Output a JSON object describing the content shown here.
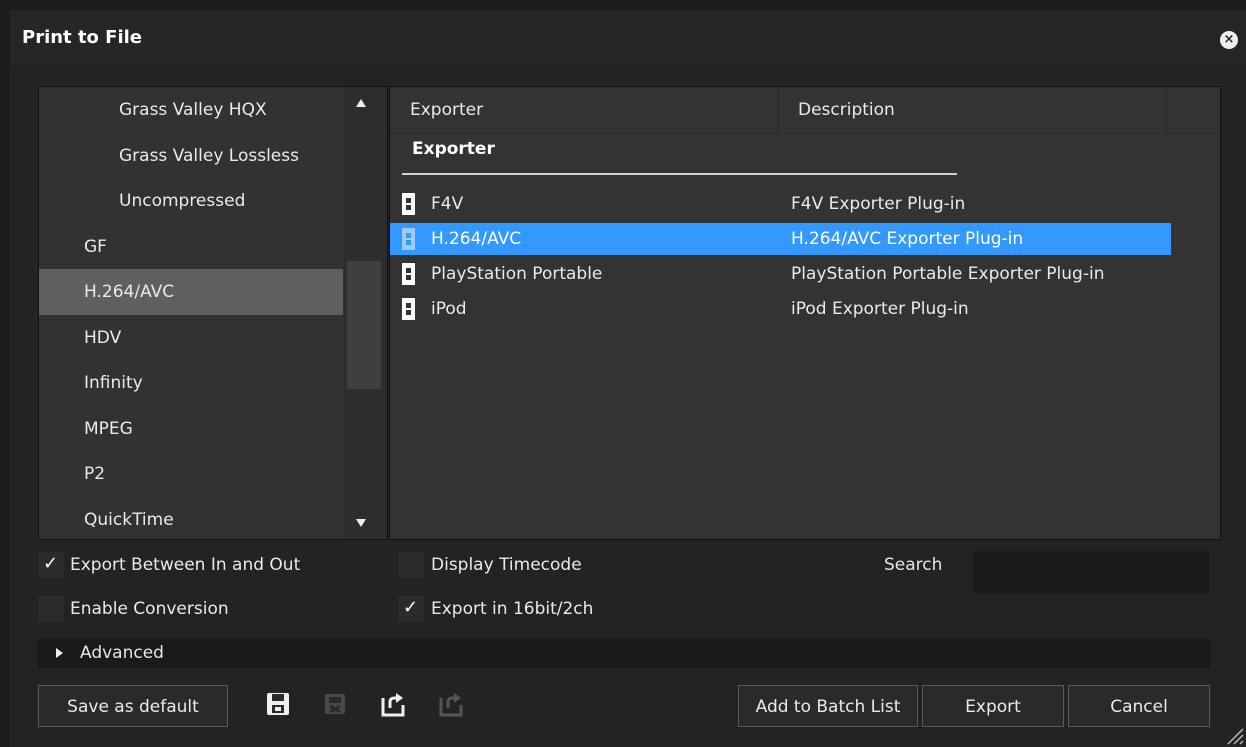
{
  "window": {
    "title": "Print to File"
  },
  "format_list": {
    "items": [
      {
        "label": "Grass Valley HQX",
        "indent": true,
        "selected": false
      },
      {
        "label": "Grass Valley Lossless",
        "indent": true,
        "selected": false
      },
      {
        "label": "Uncompressed",
        "indent": true,
        "selected": false
      },
      {
        "label": "GF",
        "indent": false,
        "selected": false
      },
      {
        "label": "H.264/AVC",
        "indent": false,
        "selected": true
      },
      {
        "label": "HDV",
        "indent": false,
        "selected": false
      },
      {
        "label": "Infinity",
        "indent": false,
        "selected": false
      },
      {
        "label": "MPEG",
        "indent": false,
        "selected": false
      },
      {
        "label": "P2",
        "indent": false,
        "selected": false
      },
      {
        "label": "QuickTime",
        "indent": false,
        "selected": false
      }
    ]
  },
  "exporter_table": {
    "columns": [
      "Exporter",
      "Description"
    ],
    "group_label": "Exporter",
    "rows": [
      {
        "exporter": "F4V",
        "description": "F4V Exporter Plug-in",
        "selected": false
      },
      {
        "exporter": "H.264/AVC",
        "description": "H.264/AVC Exporter Plug-in",
        "selected": true
      },
      {
        "exporter": "PlayStation Portable",
        "description": "PlayStation Portable Exporter Plug-in",
        "selected": false
      },
      {
        "exporter": "iPod",
        "description": "iPod Exporter Plug-in",
        "selected": false
      }
    ]
  },
  "options": {
    "export_between": {
      "label": "Export Between In and Out",
      "checked": true
    },
    "enable_conversion": {
      "label": "Enable Conversion",
      "checked": false
    },
    "display_timecode": {
      "label": "Display Timecode",
      "checked": false
    },
    "export_16bit": {
      "label": "Export in 16bit/2ch",
      "checked": true
    }
  },
  "search": {
    "label": "Search",
    "value": ""
  },
  "advanced": {
    "label": "Advanced",
    "expanded": false
  },
  "buttons": {
    "save_default": "Save as default",
    "add_batch": "Add to Batch List",
    "export": "Export",
    "cancel": "Cancel"
  },
  "icons": [
    "save-icon",
    "delete-preset-icon",
    "import-preset-icon",
    "export-preset-icon"
  ]
}
